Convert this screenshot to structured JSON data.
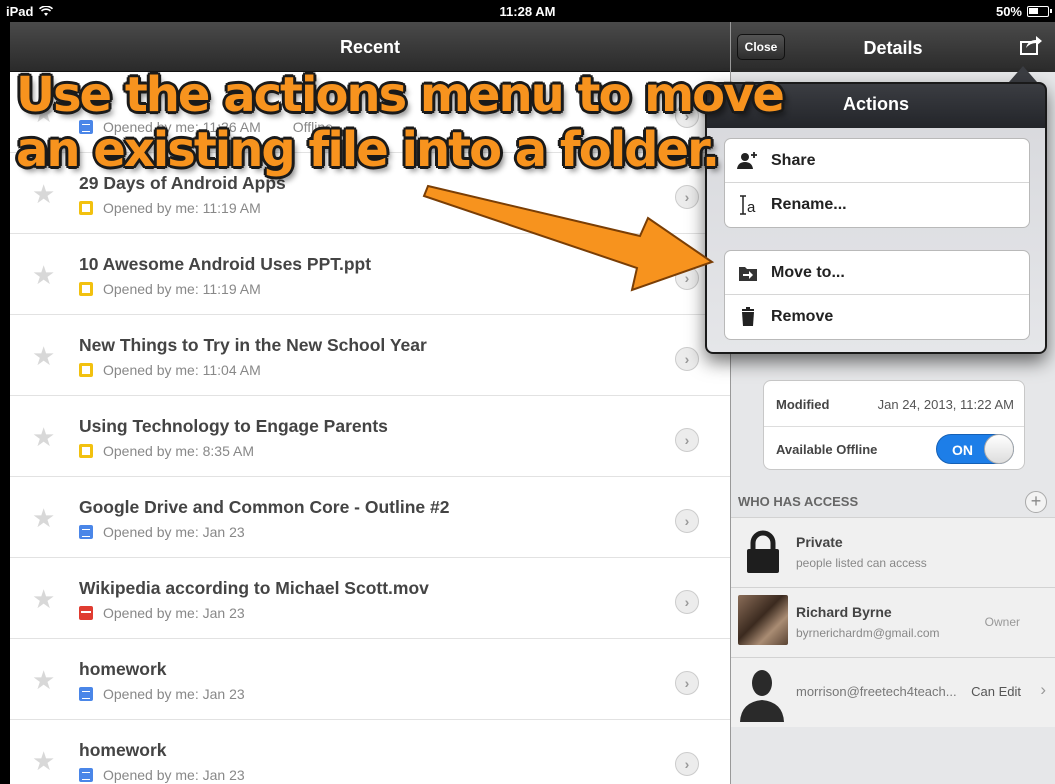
{
  "status": {
    "device": "iPad",
    "time": "11:28 AM",
    "battery": "50%"
  },
  "left": {
    "title": "Recent",
    "rows": [
      {
        "title": "",
        "meta": "Opened by me: 11:26 AM",
        "extra": "Offline",
        "icon": "doc"
      },
      {
        "title": "29 Days of Android Apps",
        "meta": "Opened by me: 11:19 AM",
        "icon": "slide"
      },
      {
        "title": "10 Awesome Android Uses PPT.ppt",
        "meta": "Opened by me: 11:19 AM",
        "icon": "slide"
      },
      {
        "title": "New Things to Try in the New School Year",
        "meta": "Opened by me: 11:04 AM",
        "icon": "slide"
      },
      {
        "title": "Using Technology to Engage Parents",
        "meta": "Opened by me: 8:35 AM",
        "icon": "slide"
      },
      {
        "title": "Google Drive and Common Core - Outline #2",
        "meta": "Opened by me: Jan 23",
        "icon": "doc"
      },
      {
        "title": "Wikipedia according to Michael Scott.mov",
        "meta": "Opened by me: Jan 23",
        "icon": "video"
      },
      {
        "title": "homework",
        "meta": "Opened by me: Jan 23",
        "icon": "doc"
      },
      {
        "title": "homework",
        "meta": "Opened by me: Jan 23",
        "icon": "doc"
      }
    ]
  },
  "right": {
    "close": "Close",
    "title": "Details",
    "modified_label": "Modified",
    "modified_value": "Jan 24, 2013, 11:22 AM",
    "offline_label": "Available Offline",
    "offline_toggle": "ON",
    "access_header": "WHO HAS ACCESS",
    "access": {
      "private_name": "Private",
      "private_sub": "people listed can access",
      "owner_name": "Richard Byrne",
      "owner_email": "byrnerichardm@gmail.com",
      "owner_role": "Owner",
      "editor_email": "morrison@freetech4teach...",
      "editor_role": "Can Edit"
    }
  },
  "actions": {
    "title": "Actions",
    "share": "Share",
    "rename": "Rename...",
    "move": "Move to...",
    "remove": "Remove"
  },
  "annotation": {
    "line1": "Use the actions menu to move",
    "line2": "an existing file into a folder."
  },
  "colors": {
    "annotation": "#f7931e",
    "toggle": "#1d7ee8"
  }
}
